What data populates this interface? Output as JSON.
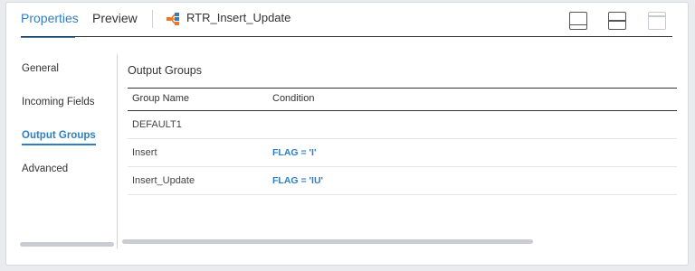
{
  "tabs": {
    "properties": "Properties",
    "preview": "Preview"
  },
  "object_title": "RTR_Insert_Update",
  "icons": {
    "router": "router-icon",
    "layout_bottom": "layout-bottom-panel-icon",
    "layout_split": "layout-split-icon",
    "layout_top": "layout-top-panel-icon"
  },
  "sidenav": {
    "items": [
      {
        "label": "General"
      },
      {
        "label": "Incoming Fields"
      },
      {
        "label": "Output Groups"
      },
      {
        "label": "Advanced"
      }
    ]
  },
  "section": {
    "title": "Output Groups"
  },
  "table": {
    "headers": [
      "Group Name",
      "Condition"
    ],
    "rows": [
      {
        "group": "DEFAULT1",
        "condition": ""
      },
      {
        "group": "Insert",
        "condition": "FLAG = 'I'"
      },
      {
        "group": "Insert_Update",
        "condition": "FLAG = 'IU'"
      }
    ]
  },
  "colors": {
    "accent": "#2f7fc1",
    "icon_orange": "#e8792b",
    "icon_blue": "#2f7fc1"
  }
}
